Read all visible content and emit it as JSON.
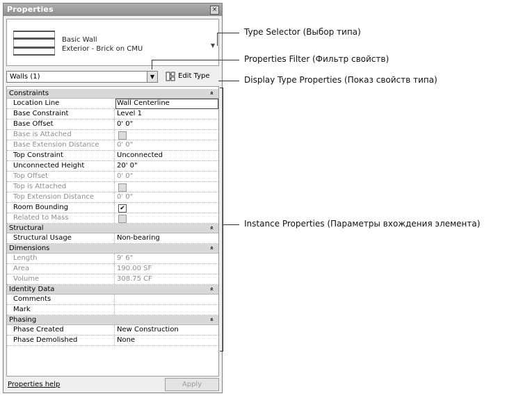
{
  "window": {
    "title": "Properties",
    "close_glyph": "×"
  },
  "type_selector": {
    "family": "Basic Wall",
    "type": "Exterior - Brick on CMU",
    "arrow_icon": "dropdown-arrow-icon"
  },
  "filter": {
    "value": "Walls (1)"
  },
  "edit_type": {
    "label": "Edit Type"
  },
  "groups": {
    "constraints": "Constraints",
    "structural": "Structural",
    "dimensions": "Dimensions",
    "identity": "Identity Data",
    "phasing": "Phasing"
  },
  "rows": {
    "location_line": {
      "name": "Location Line",
      "value": "Wall Centerline"
    },
    "base_constraint": {
      "name": "Base Constraint",
      "value": "Level 1"
    },
    "base_offset": {
      "name": "Base Offset",
      "value": "0'  0\""
    },
    "base_attached": {
      "name": "Base is Attached",
      "checked": false
    },
    "base_ext": {
      "name": "Base Extension Distance",
      "value": "0'  0\""
    },
    "top_constraint": {
      "name": "Top Constraint",
      "value": "Unconnected"
    },
    "unconnected_height": {
      "name": "Unconnected Height",
      "value": "20'  0\""
    },
    "top_offset": {
      "name": "Top Offset",
      "value": "0'  0\""
    },
    "top_attached": {
      "name": "Top is Attached",
      "checked": false
    },
    "top_ext": {
      "name": "Top Extension Distance",
      "value": "0'  0\""
    },
    "room_bounding": {
      "name": "Room Bounding",
      "checked": true
    },
    "related_mass": {
      "name": "Related to Mass",
      "checked": false
    },
    "structural_usage": {
      "name": "Structural Usage",
      "value": "Non-bearing"
    },
    "length": {
      "name": "Length",
      "value": "9'  6\""
    },
    "area": {
      "name": "Area",
      "value": "190.00 SF"
    },
    "volume": {
      "name": "Volume",
      "value": "308.75 CF"
    },
    "comments": {
      "name": "Comments",
      "value": ""
    },
    "mark": {
      "name": "Mark",
      "value": ""
    },
    "phase_created": {
      "name": "Phase Created",
      "value": "New Construction"
    },
    "phase_demolished": {
      "name": "Phase Demolished",
      "value": "None"
    }
  },
  "check_glyph": "✔",
  "chevron_glyph": "»",
  "footer": {
    "help_link": "Properties help",
    "apply": "Apply"
  },
  "callouts": {
    "type_selector": "Type Selector (Выбор типа)",
    "properties_filter": "Properties Filter (Фильтр свойств)",
    "display_type": "Display Type Properties (Показ свойств типа)",
    "instance": "Instance Properties (Параметры вхождения элемента)"
  }
}
